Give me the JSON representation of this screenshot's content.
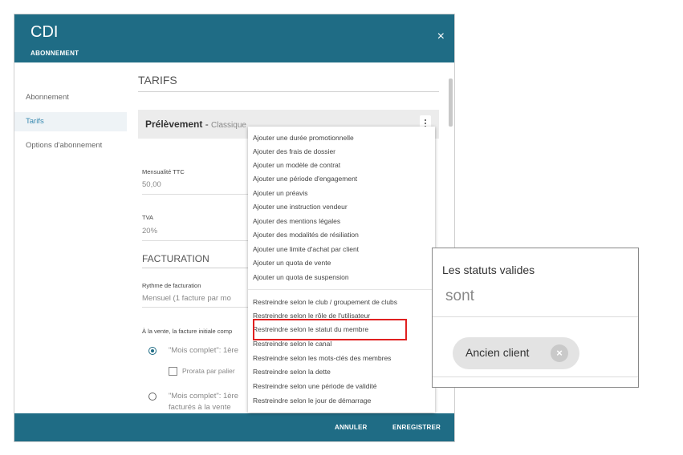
{
  "dialog": {
    "title": "CDI",
    "subtitle": "ABONNEMENT",
    "close_icon": "×"
  },
  "sidebar": {
    "items": [
      {
        "label": "Abonnement",
        "active": false
      },
      {
        "label": "Tarifs",
        "active": true
      },
      {
        "label": "Options d'abonnement",
        "active": false
      }
    ]
  },
  "main": {
    "section_tarifs": "TARIFS",
    "card": {
      "title": "Prélèvement",
      "separator": " - ",
      "subtitle": "Classique"
    },
    "mensualite": {
      "label": "Mensualité TTC",
      "value": "50,00"
    },
    "tva": {
      "label": "TVA",
      "value": "20%"
    },
    "section_facturation": "FACTURATION",
    "rythme": {
      "label": "Rythme de facturation",
      "value": "Mensuel (1 facture par mo"
    },
    "vente_label": "À la vente, la facture initiale comp",
    "option1": "\"Mois complet\": 1ère",
    "prorata": "Prorata par palier",
    "option2_line1": "\"Mois complet\": 1ère",
    "option2_line2": "facturés à la vente"
  },
  "dropdown": {
    "group1": [
      "Ajouter une durée promotionnelle",
      "Ajouter des frais de dossier",
      "Ajouter un modèle de contrat",
      "Ajouter une période d'engagement",
      "Ajouter un préavis",
      "Ajouter une instruction vendeur",
      "Ajouter des mentions légales",
      "Ajouter des modalités de résiliation",
      "Ajouter une limite d'achat par client",
      "Ajouter un quota de vente",
      "Ajouter un quota de suspension"
    ],
    "group2": [
      "Restreindre selon le club / groupement de clubs",
      "Restreindre selon le rôle de l'utilisateur",
      "Restreindre selon le statut du membre",
      "Restreindre selon le canal",
      "Restreindre selon les mots-clés des membres",
      "Restreindre selon la dette",
      "Restreindre selon une période de validité",
      "Restreindre selon le jour de démarrage"
    ]
  },
  "footer": {
    "cancel": "ANNULER",
    "save": "ENREGISTRER"
  },
  "zoom_panel": {
    "label": "Les statuts valides",
    "operator": "sont",
    "chip": "Ancien client"
  },
  "colors": {
    "header": "#1f6c85",
    "highlight": "#e02020",
    "active_item": "#3a8ab0"
  }
}
